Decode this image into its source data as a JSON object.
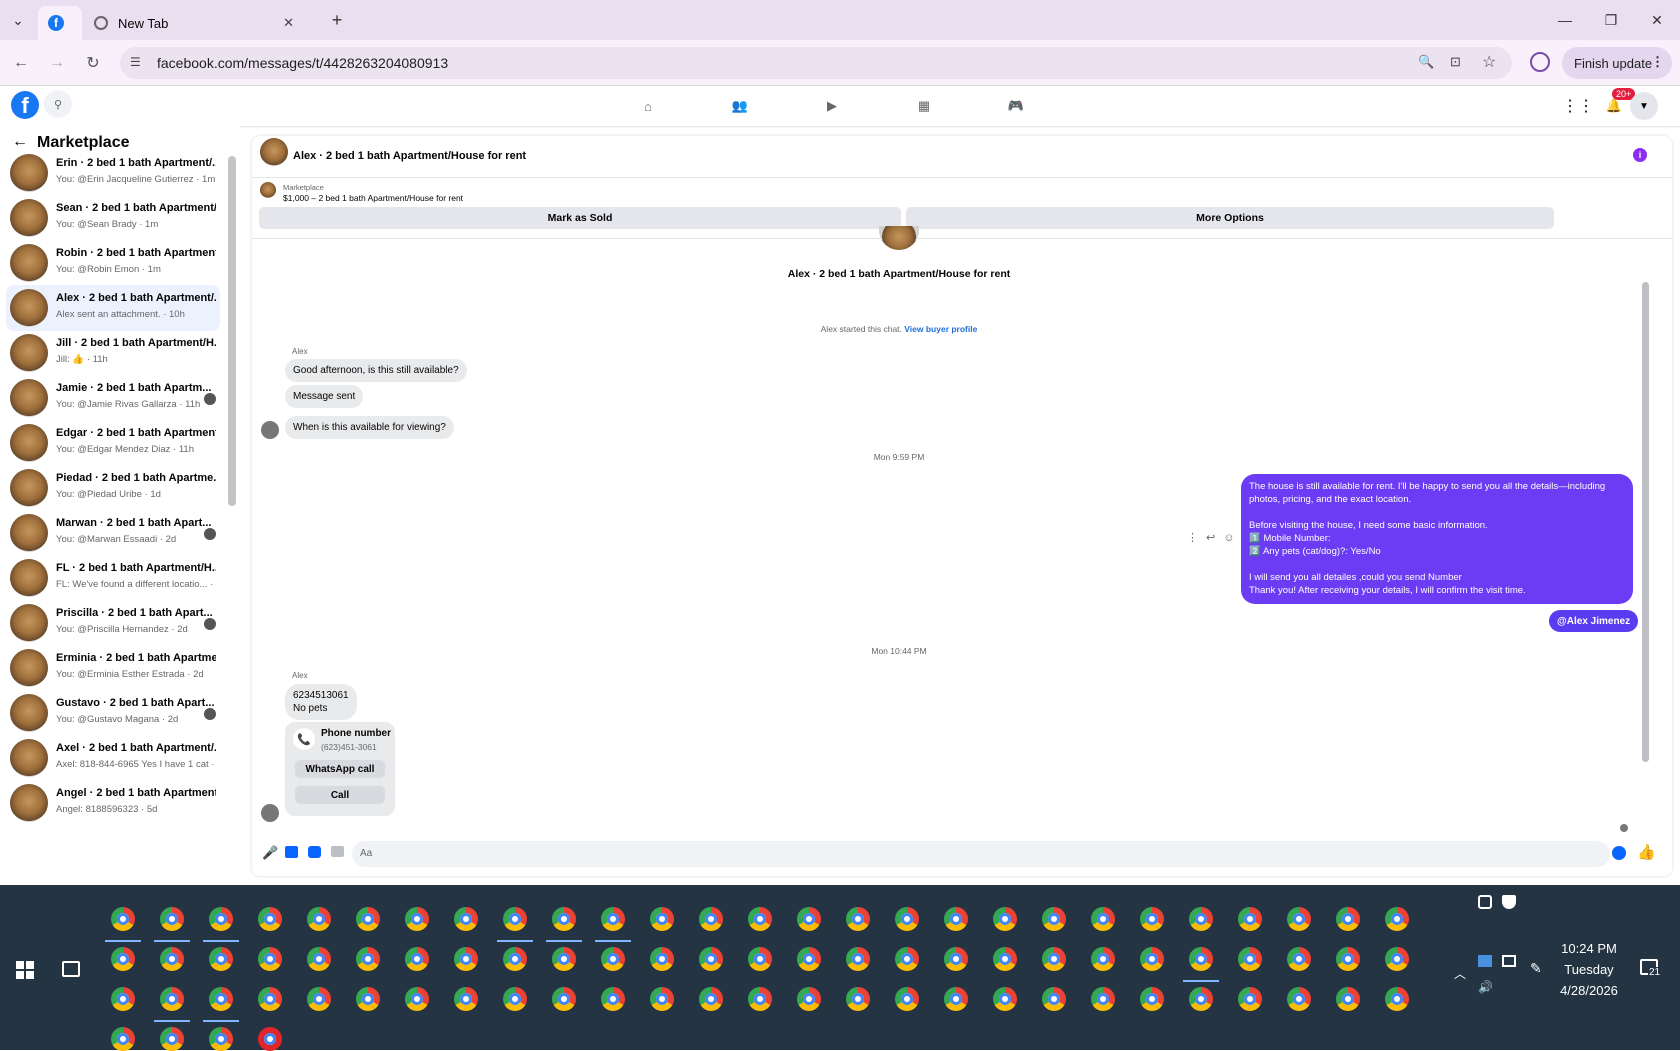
{
  "browser": {
    "tabs": [
      {
        "label": ""
      },
      {
        "label": "New Tab"
      }
    ],
    "url": "facebook.com/messages/t/4428263204080913",
    "finish_update": "Finish update"
  },
  "fb": {
    "notif_badge": "20+"
  },
  "left": {
    "title": "Marketplace",
    "conversations": [
      {
        "title": "Erin · 2 bed 1 bath Apartment/...",
        "sub": "You: @Erin Jacqueline Gutierrez · 1m"
      },
      {
        "title": "Sean · 2 bed 1 bath Apartment/...",
        "sub": "You: @Sean Brady · 1m"
      },
      {
        "title": "Robin · 2 bed 1 bath Apartment...",
        "sub": "You: @Robin Emon · 1m"
      },
      {
        "title": "Alex · 2 bed 1 bath Apartment/...",
        "sub": "Alex sent an attachment. · 10h"
      },
      {
        "title": "Jill · 2 bed 1 bath Apartment/H...",
        "sub": "Jill: 👍 · 11h"
      },
      {
        "title": "Jamie · 2 bed 1 bath Apartm...",
        "sub": "You: @Jamie Rivas Gallarza · 11h"
      },
      {
        "title": "Edgar · 2 bed 1 bath Apartment...",
        "sub": "You: @Edgar Mendez Diaz · 11h"
      },
      {
        "title": "Piedad · 2 bed 1 bath Apartme...",
        "sub": "You: @Piedad Uribe · 1d"
      },
      {
        "title": "Marwan · 2 bed 1 bath Apart...",
        "sub": "You: @Marwan Essaadi · 2d"
      },
      {
        "title": "FL · 2 bed 1 bath Apartment/H...",
        "sub": "FL: We've found a different locatio... · 2d"
      },
      {
        "title": "Priscilla · 2 bed 1 bath Apart...",
        "sub": "You: @Priscilla Hernandez · 2d"
      },
      {
        "title": "Erminia · 2 bed 1 bath Apartme...",
        "sub": "You: @Erminia Esther Estrada · 2d"
      },
      {
        "title": "Gustavo · 2 bed 1 bath Apart...",
        "sub": "You: @Gustavo Magana · 2d"
      },
      {
        "title": "Axel · 2 bed 1 bath Apartment/...",
        "sub": "Axel: 818-844-6965 Yes I have 1 cat · 3d"
      },
      {
        "title": "Angel · 2 bed 1 bath Apartment...",
        "sub": "Angel: 8188596323 · 5d"
      }
    ]
  },
  "chat": {
    "header_title": "Alex · 2 bed 1 bath Apartment/House for rent",
    "listing_source": "Marketplace",
    "listing_line": "$1,000 – 2 bed 1 bath Apartment/House for rent",
    "mark_sold": "Mark as Sold",
    "more_options": "More Options",
    "profile_title": "Alex · 2 bed 1 bath Apartment/House for rent",
    "started": "Alex started this chat.",
    "view_profile": "View buyer profile",
    "sender1": "Alex",
    "msg1": "Good afternoon, is this still available?",
    "msg2": "Message sent",
    "msg3": "When is this available for viewing?",
    "time1": "Mon 9:59 PM",
    "out_lines": [
      "The house is still available for rent. I'll be happy to send you all the details—including",
      "photos, pricing, and the exact location.",
      "",
      "Before visiting the house, I need some basic information.",
      "1️⃣  Mobile Number:",
      "2️⃣  Any pets (cat/dog)?: Yes/No",
      "",
      "I will send you all detailes ,could you send Number",
      "Thank you! After receiving your details, I will confirm the visit time."
    ],
    "mention": "@Alex Jimenez",
    "time2": "Mon 10:44 PM",
    "sender2": "Alex",
    "msg4_l1": "6234513061",
    "msg4_l2": "No pets",
    "phone_label": "Phone number",
    "phone_value": "(623)451-3061",
    "whatsapp": "WhatsApp call",
    "call": "Call",
    "input_placeholder": "Aa"
  },
  "taskbar": {
    "time": "10:24 PM",
    "day": "Tuesday",
    "date": "4/28/2026",
    "notif": "21"
  }
}
